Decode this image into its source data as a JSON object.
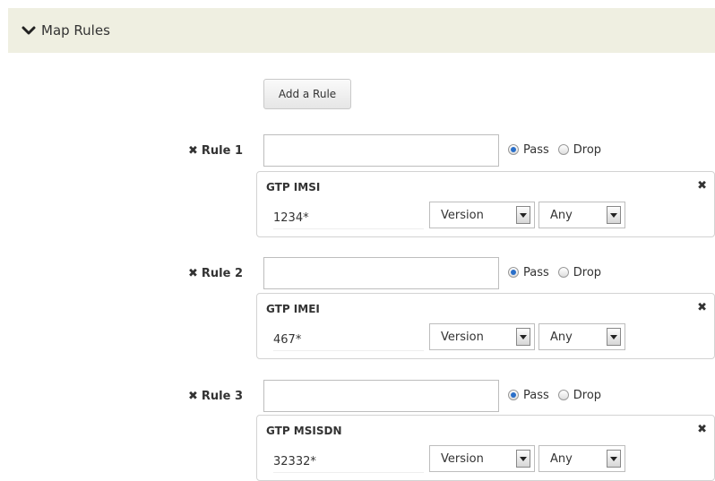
{
  "section": {
    "title": "Map Rules",
    "icon": "chevron-down-icon"
  },
  "add_button": {
    "label": "Add a Rule"
  },
  "radio_labels": {
    "pass": "Pass",
    "drop": "Drop"
  },
  "rules": [
    {
      "label": "Rule 1",
      "name_value": "",
      "selected": "Pass",
      "card": {
        "title": "GTP IMSI",
        "value": "1234*",
        "version": "Version",
        "any": "Any"
      }
    },
    {
      "label": "Rule 2",
      "name_value": "",
      "selected": "Pass",
      "card": {
        "title": "GTP IMEI",
        "value": "467*",
        "version": "Version",
        "any": "Any"
      }
    },
    {
      "label": "Rule 3",
      "name_value": "",
      "selected": "Pass",
      "card": {
        "title": "GTP MSISDN",
        "value": "32332*",
        "version": "Version",
        "any": "Any"
      }
    }
  ],
  "icons": {
    "remove": "remove-x-icon",
    "close": "close-icon",
    "dropdown": "dropdown-arrow-icon"
  }
}
